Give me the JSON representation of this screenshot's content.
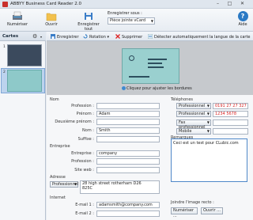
{
  "window": {
    "title": "ABBYY Business Card Reader 2.0",
    "minimize": "–",
    "maximize": "□",
    "close": "✕"
  },
  "ribbon": {
    "scan": "Numériser",
    "open": "Ouvrir",
    "save_all": "Enregistrer tout",
    "save_to_label": "Enregistrer sous :",
    "save_to_value": "Pièce jointe vCard",
    "help": "Aide",
    "help_glyph": "?"
  },
  "left_panel": {
    "title": "Cartes",
    "gear_glyph": "⚙",
    "arrow_glyph": "▾",
    "cards": [
      "1",
      "2"
    ]
  },
  "toolbar": {
    "save": "Enregistrer",
    "rotate": "Rotation",
    "delete": "Supprimer",
    "detect": "Détecter automatiquement la langue de la carte"
  },
  "image_hint": "Cliquez pour ajuster les bordures",
  "form": {
    "sections": {
      "name": "Nom",
      "company_section": "Entreprise",
      "address_section": "Adresse",
      "internet": "Internet"
    },
    "labels": {
      "profession1": "Profession :",
      "first_name": "Prénom :",
      "middle_name": "Deuxième prénom :",
      "last_name": "Nom :",
      "suffix": "Suffixe :",
      "company": "Entreprise :",
      "profession2": "Profession :",
      "website": "Site web :",
      "email1": "E-mail 1 :",
      "email2": "E-mail 2 :"
    },
    "values": {
      "first_name": "Adam",
      "last_name": "Smith",
      "company": "company",
      "address_type": "Professionnel",
      "address_line1": "28 high street rotherham D26",
      "address_line2": "825C",
      "email1": "adamsmith@company.com"
    },
    "phones": {
      "title": "Téléphones",
      "rows": [
        {
          "type": "Professionnel",
          "value": "0191 27 27 327"
        },
        {
          "type": "Professionnel",
          "value": "1234 5678"
        },
        {
          "type": "Fax professionnel",
          "value": ""
        },
        {
          "type": "Mobile",
          "value": ""
        }
      ]
    },
    "remarks": {
      "title": "Remarques",
      "text": "Ceci est un test pour CLubic.com"
    },
    "attach": {
      "title": "Joindre l'image recto :",
      "scan": "Numériser ...",
      "open": "Ouvrir ..."
    }
  }
}
